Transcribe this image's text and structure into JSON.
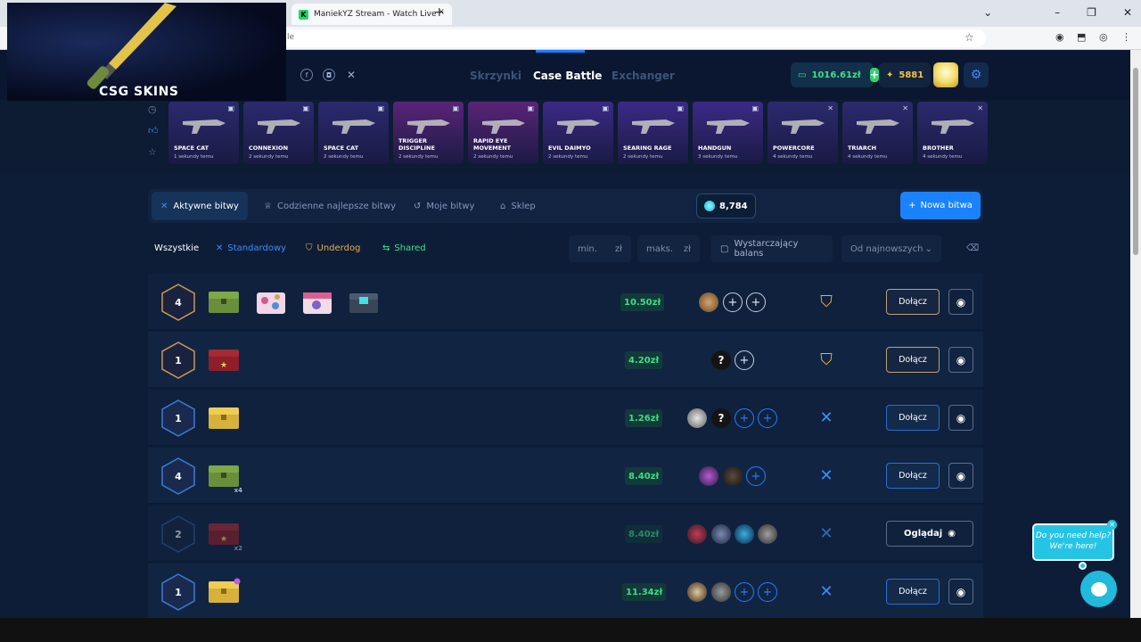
{
  "browser": {
    "tab_title": "ManiekYZ Stream - Watch Live",
    "address_fragment": "le",
    "tab_close": "×",
    "new_tab": "+"
  },
  "overlay": {
    "logo_text": "CSG SKINS"
  },
  "header": {
    "nav": [
      {
        "label": "Skrzynki",
        "active": false
      },
      {
        "label": "Case Battle",
        "active": true
      },
      {
        "label": "Exchanger",
        "active": false
      }
    ],
    "balance": "1016.61zł",
    "coins": "5881"
  },
  "live_drops": [
    {
      "name": "SPACE CAT",
      "time": "1 sekundy temu",
      "bg": "#2b2a6e"
    },
    {
      "name": "CONNEXION",
      "time": "2 sekundy temu",
      "bg": "#2b2a6e"
    },
    {
      "name": "SPACE CAT",
      "time": "2 sekundy temu",
      "bg": "#2b2a6e"
    },
    {
      "name": "TRIGGER DISCIPLINE",
      "time": "2 sekundy temu",
      "bg": "#5a2478"
    },
    {
      "name": "RAPID EYE MOVEMENT",
      "time": "2 sekundy temu",
      "bg": "#5a2478"
    },
    {
      "name": "EVIL DAIMYO",
      "time": "2 sekundy temu",
      "bg": "#3b2a86"
    },
    {
      "name": "SEARING RAGE",
      "time": "2 sekundy temu",
      "bg": "#3b2a86"
    },
    {
      "name": "HANDGUN",
      "time": "3 sekundy temu",
      "bg": "#3b2a86"
    },
    {
      "name": "POWERCORE",
      "time": "4 sekundy temu",
      "bg": "#2b2a6e"
    },
    {
      "name": "TRIARCH",
      "time": "4 sekundy temu",
      "bg": "#2b2a6e"
    },
    {
      "name": "BROTHER",
      "time": "4 sekundy temu",
      "bg": "#2b2a6e"
    }
  ],
  "toolbar": {
    "active_battles": "Aktywne bitwy",
    "daily_best": "Codzienne najlepsze bitwy",
    "my_battles": "Moje bitwy",
    "shop": "Sklep",
    "gems": "8,784",
    "new_battle": "Nowa bitwa"
  },
  "filters": {
    "all": "Wszystkie",
    "standard": "Standardowy",
    "underdog": "Underdog",
    "shared": "Shared",
    "min_placeholder": "min.",
    "max_placeholder": "maks.",
    "currency": "zł",
    "enough_balance": "Wystarczający balans",
    "sort": "Od najnowszych"
  },
  "battles": [
    {
      "round": "4",
      "mode": "underdog",
      "price": "10.50zł",
      "button": "Dołącz"
    },
    {
      "round": "1",
      "mode": "underdog",
      "price": "4.20zł",
      "button": "Dołącz"
    },
    {
      "round": "1",
      "mode": "standard",
      "price": "1.26zł",
      "button": "Dołącz"
    },
    {
      "round": "4",
      "mode": "standard",
      "price": "8.40zł",
      "case_mult": "x4",
      "button": "Dołącz"
    },
    {
      "round": "2",
      "mode": "standard",
      "price": "8.40zł",
      "case_mult": "x2",
      "button": "Oglądaj"
    },
    {
      "round": "1",
      "mode": "standard",
      "price": "11.34zł",
      "button": "Dołącz"
    }
  ],
  "help": {
    "line1": "Do you need help?",
    "line2": "We're here!"
  },
  "colors": {
    "accent": "#1a82ff",
    "money": "#3fdc84",
    "coins": "#f5c53c",
    "underdog": "#e8b04a"
  }
}
